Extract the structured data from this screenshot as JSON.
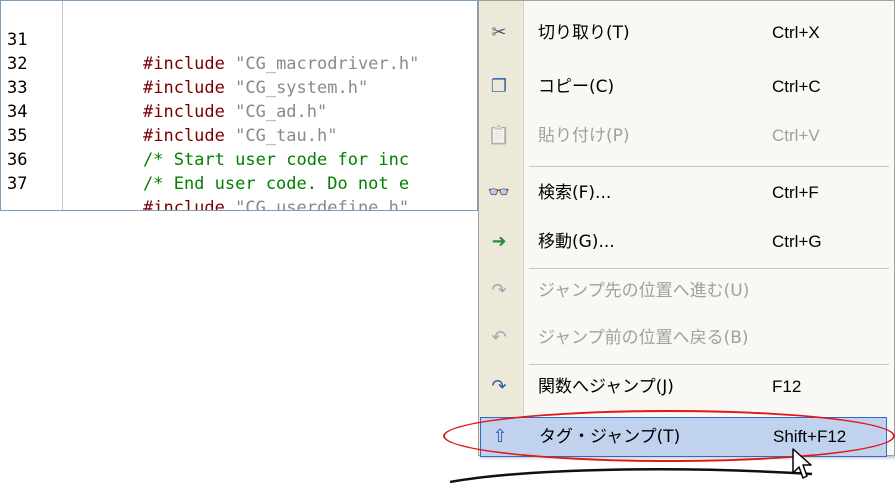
{
  "editor": {
    "lines": [
      {
        "num": "31",
        "kw": "#include",
        "rest": " \"CG_macrodriver.h\"",
        "kind": "include"
      },
      {
        "num": "32",
        "kw": "#include",
        "rest": " \"CG_system.h\"",
        "kind": "include"
      },
      {
        "num": "33",
        "kw": "#include",
        "rest": " \"CG_ad.h\"",
        "kind": "include"
      },
      {
        "num": "34",
        "kw": "#include",
        "rest": " \"CG_tau.h\"",
        "kind": "include"
      },
      {
        "num": "35",
        "kw": "",
        "rest": "/* Start user code for inc",
        "kind": "comment"
      },
      {
        "num": "36",
        "kw": "",
        "rest": "/* End user code. Do not e",
        "kind": "comment"
      },
      {
        "num": "37",
        "kw": "#include",
        "rest": " \"CG_userdefine.h\"",
        "kind": "include"
      }
    ]
  },
  "menu": {
    "items": [
      {
        "label": "切り取り(T)",
        "shortcut": "Ctrl+X",
        "icon": "scissors-icon",
        "glyph": "✂",
        "enabled": true
      },
      {
        "label": "コピー(C)",
        "shortcut": "Ctrl+C",
        "icon": "copy-icon",
        "glyph": "❐",
        "enabled": true
      },
      {
        "label": "貼り付け(P)",
        "shortcut": "Ctrl+V",
        "icon": "paste-icon",
        "glyph": "📋",
        "enabled": false
      },
      {
        "label": "検索(F)...",
        "shortcut": "Ctrl+F",
        "icon": "binoculars-icon",
        "glyph": "👓",
        "enabled": true
      },
      {
        "label": "移動(G)...",
        "shortcut": "Ctrl+G",
        "icon": "goto-icon",
        "glyph": "➜",
        "enabled": true
      },
      {
        "label": "ジャンプ先の位置へ進む(U)",
        "shortcut": "",
        "icon": "forward-arrow-icon",
        "glyph": "↷",
        "enabled": false
      },
      {
        "label": "ジャンプ前の位置へ戻る(B)",
        "shortcut": "",
        "icon": "back-arrow-icon",
        "glyph": "↶",
        "enabled": false
      },
      {
        "label": "関数へジャンプ(J)",
        "shortcut": "F12",
        "icon": "jump-function-icon",
        "glyph": "↷",
        "enabled": true
      },
      {
        "label": "タグ・ジャンプ(T)",
        "shortcut": "Shift+F12",
        "icon": "tag-jump-icon",
        "glyph": "⇧",
        "enabled": true,
        "highlighted": true
      }
    ]
  },
  "colors": {
    "include_keyword": "#7a0000",
    "string": "#8a8a8a",
    "comment": "#008000",
    "highlight": "#c1d2ee",
    "annotation_ring": "#e01818"
  }
}
